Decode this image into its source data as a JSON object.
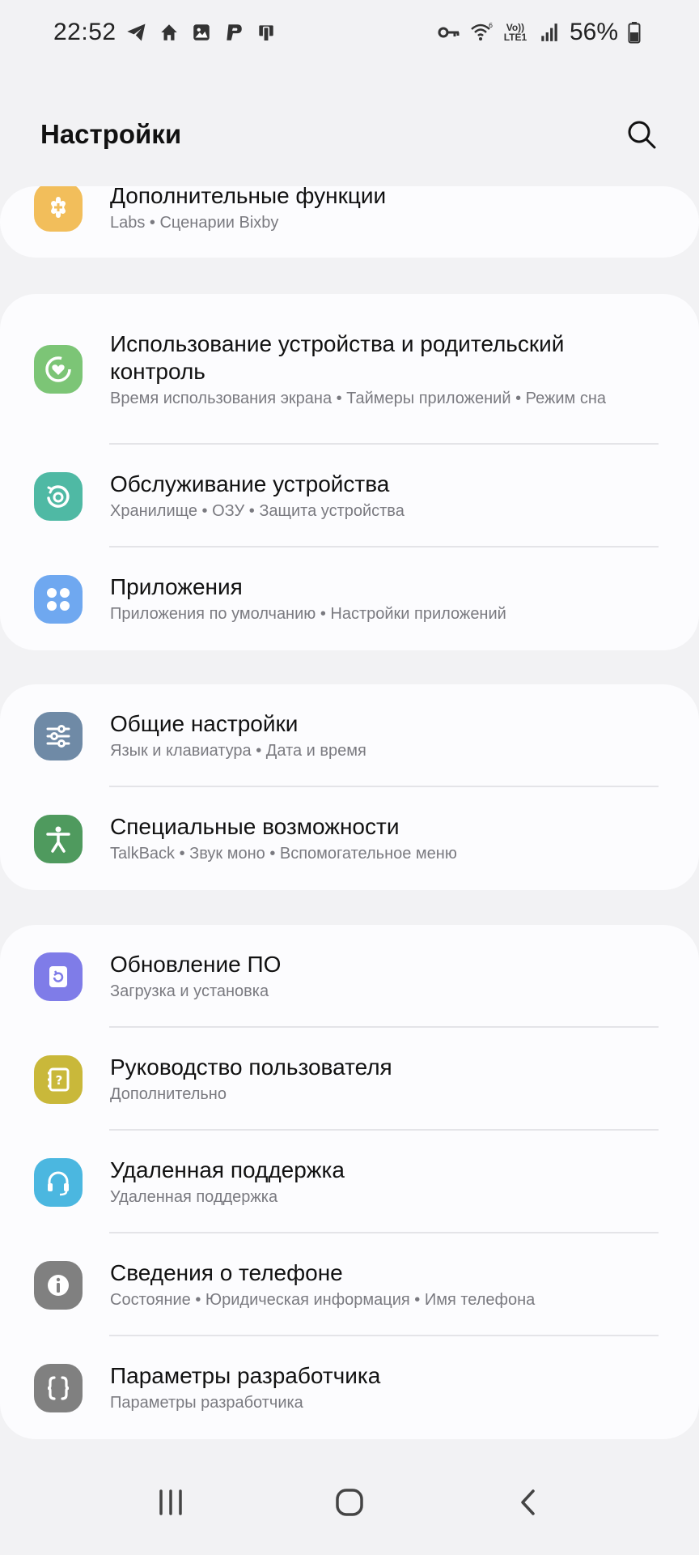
{
  "status_bar": {
    "time": "22:52",
    "battery": "56%",
    "network_label_top": "Vo))",
    "network_label_bottom": "LTE1",
    "left_icons": [
      "telegram-icon",
      "home-icon",
      "gallery-icon",
      "p-app-icon",
      "device-icon"
    ],
    "right_icons": [
      "vpn-key-icon",
      "wifi-6-icon",
      "volte-icon",
      "signal-icon",
      "battery-icon"
    ]
  },
  "header": {
    "title": "Настройки"
  },
  "cards": [
    {
      "items": [
        {
          "title": "Дополнительные функции",
          "subtitle": "Labs • Сценарии Bixby",
          "icon": "advanced-features-icon",
          "color": "#f2be5b"
        }
      ]
    },
    {
      "items": [
        {
          "title": "Использование устройства и родительский контроль",
          "subtitle": "Время использования экрана • Таймеры приложений • Режим сна",
          "icon": "digital-wellbeing-icon",
          "color": "#7cc576"
        },
        {
          "title": "Обслуживание устройства",
          "subtitle": "Хранилище • ОЗУ • Защита устройства",
          "icon": "device-care-icon",
          "color": "#4fb9a4"
        },
        {
          "title": "Приложения",
          "subtitle": "Приложения по умолчанию • Настройки приложений",
          "icon": "apps-icon",
          "color": "#6fa8f0"
        }
      ]
    },
    {
      "items": [
        {
          "title": "Общие настройки",
          "subtitle": "Язык и клавиатура • Дата и время",
          "icon": "general-management-icon",
          "color": "#6f8aa6"
        },
        {
          "title": "Специальные возможности",
          "subtitle": "TalkBack • Звук моно • Вспомогательное меню",
          "icon": "accessibility-icon",
          "color": "#4f9a5e"
        }
      ]
    },
    {
      "items": [
        {
          "title": "Обновление ПО",
          "subtitle": "Загрузка и установка",
          "icon": "software-update-icon",
          "color": "#7f7ce8"
        },
        {
          "title": "Руководство пользователя",
          "subtitle": "Дополнительно",
          "icon": "user-manual-icon",
          "color": "#c9b83a"
        },
        {
          "title": "Удаленная поддержка",
          "subtitle": "Удаленная поддержка",
          "icon": "remote-support-icon",
          "color": "#4bb7e0"
        },
        {
          "title": "Сведения о телефоне",
          "subtitle": "Состояние • Юридическая информация • Имя телефона",
          "icon": "about-phone-icon",
          "color": "#808080"
        },
        {
          "title": "Параметры разработчика",
          "subtitle": "Параметры разработчика",
          "icon": "developer-options-icon",
          "color": "#808080"
        }
      ]
    }
  ],
  "nav_bar": {
    "buttons": [
      "recent-apps-icon",
      "home-icon",
      "back-icon"
    ]
  }
}
